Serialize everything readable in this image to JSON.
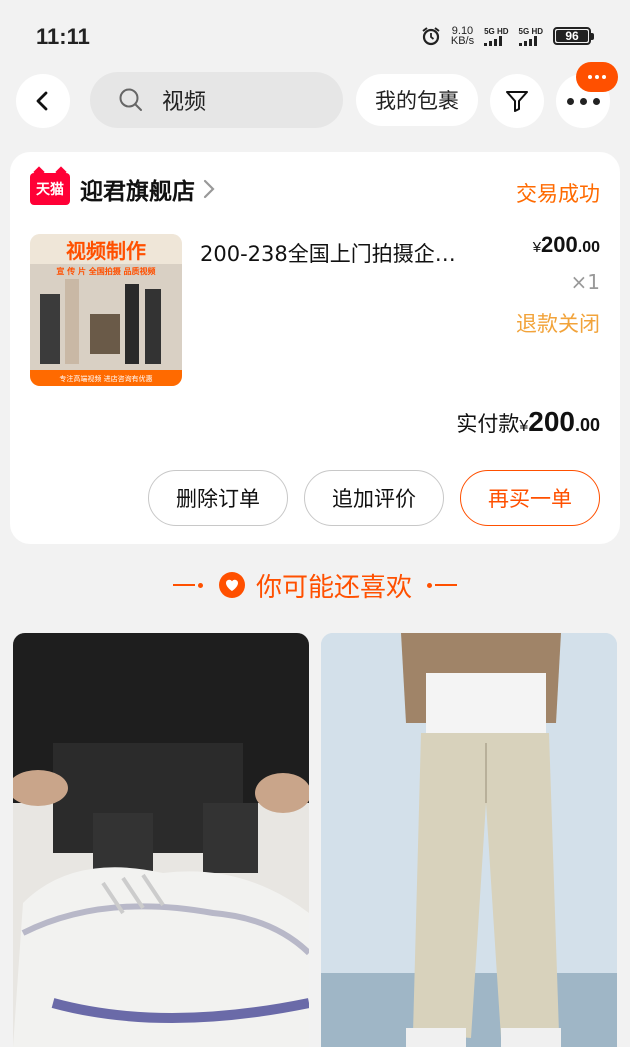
{
  "status_bar": {
    "time": "11:11",
    "net_speed_value": "9.10",
    "net_speed_unit": "KB/s",
    "sim1_label": "5G HD",
    "sim2_label": "5G HD",
    "battery": "96"
  },
  "nav": {
    "search_query": "视频",
    "packages_label": "我的包裹"
  },
  "order": {
    "shop_badge": "天猫",
    "shop_name": "迎君旗舰店",
    "status": "交易成功",
    "product_title": "200-238全国上门拍摄企…",
    "thumb_title": "视频制作",
    "thumb_sub": "宣 传 片  全国拍摄  品质视频",
    "thumb_footer": "专注高端视频  进店咨询有优惠",
    "price_currency": "¥",
    "price_int": "200",
    "price_dec": ".00",
    "quantity": "×1",
    "refund_status": "退款关闭",
    "paid_label": "实付款",
    "paid_currency": "¥",
    "paid_int": "200",
    "paid_dec": ".00",
    "buttons": {
      "delete": "删除订单",
      "review": "追加评价",
      "rebuy": "再买一单"
    }
  },
  "recommend": {
    "title": "你可能还喜欢"
  },
  "colors": {
    "accent": "#ff5000",
    "status_orange": "#ff6a00",
    "refund_orange": "#f2a33a",
    "tmall_red": "#ff0036"
  },
  "icons": [
    "back-arrow-icon",
    "search-icon",
    "filter-icon",
    "more-icon",
    "tmall-logo",
    "chevron-right-icon",
    "heart-icon",
    "alarm-icon"
  ]
}
